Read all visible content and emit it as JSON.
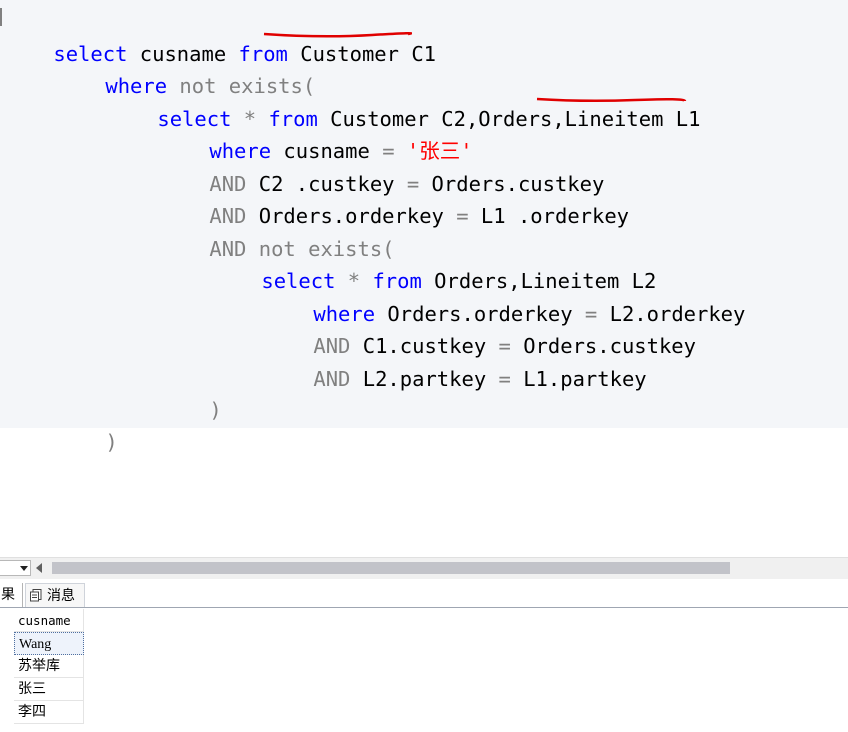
{
  "editor": {
    "lines": [
      [
        {
          "t": "select",
          "c": "kw"
        },
        {
          "t": " cusname ",
          "c": "txt"
        },
        {
          "t": "from",
          "c": "kw"
        },
        {
          "t": " Customer C1",
          "c": "txt"
        }
      ],
      [
        {
          "t": "where",
          "c": "kw"
        },
        {
          "t": " not exists(",
          "c": "gray"
        }
      ],
      [
        {
          "t": "select",
          "c": "kw"
        },
        {
          "t": " * ",
          "c": "gray"
        },
        {
          "t": "from",
          "c": "kw"
        },
        {
          "t": " Customer C2,Orders,Lineitem L1",
          "c": "txt"
        }
      ],
      [
        {
          "t": "where",
          "c": "kw"
        },
        {
          "t": " cusname ",
          "c": "txt"
        },
        {
          "t": "= ",
          "c": "gray"
        },
        {
          "t": "'张三'",
          "c": "str"
        }
      ],
      [
        {
          "t": "AND",
          "c": "gray"
        },
        {
          "t": " C2 .custkey ",
          "c": "txt"
        },
        {
          "t": "=",
          "c": "gray"
        },
        {
          "t": " Orders.custkey",
          "c": "txt"
        }
      ],
      [
        {
          "t": "AND",
          "c": "gray"
        },
        {
          "t": " Orders.orderkey ",
          "c": "txt"
        },
        {
          "t": "=",
          "c": "gray"
        },
        {
          "t": " L1 .orderkey",
          "c": "txt"
        }
      ],
      [
        {
          "t": "AND not exists(",
          "c": "gray"
        }
      ],
      [
        {
          "t": "select",
          "c": "kw"
        },
        {
          "t": " * ",
          "c": "gray"
        },
        {
          "t": "from",
          "c": "kw"
        },
        {
          "t": " Orders,Lineitem L2",
          "c": "txt"
        }
      ],
      [
        {
          "t": "where",
          "c": "kw"
        },
        {
          "t": " Orders.orderkey ",
          "c": "txt"
        },
        {
          "t": "=",
          "c": "gray"
        },
        {
          "t": " L2.orderkey",
          "c": "txt"
        }
      ],
      [
        {
          "t": "AND",
          "c": "gray"
        },
        {
          "t": " C1.custkey ",
          "c": "txt"
        },
        {
          "t": "=",
          "c": "gray"
        },
        {
          "t": " Orders.custkey",
          "c": "txt"
        }
      ],
      [
        {
          "t": "AND",
          "c": "gray"
        },
        {
          "t": " L2.partkey ",
          "c": "txt"
        },
        {
          "t": "=",
          "c": "gray"
        },
        {
          "t": " L1.partkey",
          "c": "txt"
        }
      ],
      [
        {
          "t": ")",
          "c": "gray"
        }
      ],
      [
        {
          "t": ")",
          "c": "gray"
        }
      ]
    ],
    "annotation_color": "#e00000"
  },
  "tabs": {
    "results": "果",
    "messages": "消息"
  },
  "results": {
    "header": "cusname",
    "rows": [
      "Wang",
      "苏举库",
      "张三",
      "李四"
    ]
  },
  "colors": {
    "keyword": "#0000ff",
    "operator": "#808080",
    "string": "#ff0000",
    "editor_bg": "#f4f6f9"
  }
}
